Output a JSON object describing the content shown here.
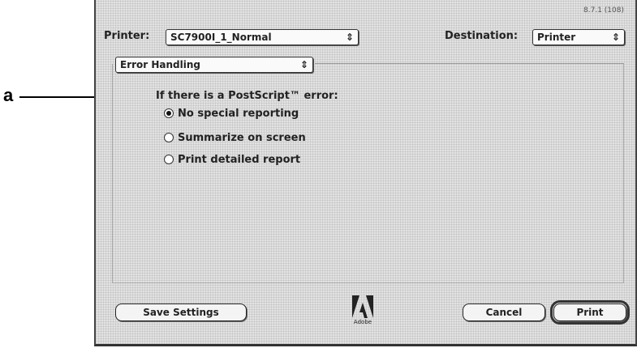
{
  "callout": {
    "letter": "a"
  },
  "dialog": {
    "version": "8.7.1 (108)",
    "printer_label": "Printer:",
    "printer_value": "SC7900I_1_Normal",
    "destination_label": "Destination:",
    "destination_value": "Printer",
    "panel_value": "Error Handling",
    "section_title": "If there is a PostScript™ error:",
    "options": [
      {
        "label": "No special reporting",
        "selected": true
      },
      {
        "label": "Summarize on screen",
        "selected": false
      },
      {
        "label": "Print detailed report",
        "selected": false
      }
    ],
    "buttons": {
      "save": "Save Settings",
      "cancel": "Cancel",
      "print": "Print"
    },
    "logo_text": "Adobe",
    "popup_arrows": "⇕"
  }
}
